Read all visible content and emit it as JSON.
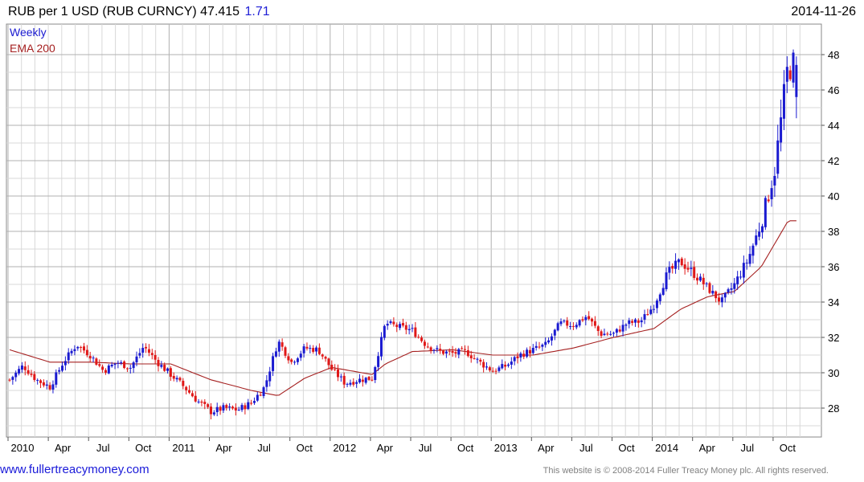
{
  "header": {
    "title": "RUB per 1 USD (RUB CURNCY) 47.415",
    "change": "1.71",
    "date": "2014-11-26"
  },
  "legend": {
    "weekly": "Weekly",
    "ema": "EMA 200"
  },
  "footer": {
    "link": "www.fullertreacymoney.com",
    "copyright": "This website is © 2008-2014 Fuller Treacy Money plc. All rights reserved."
  },
  "colors": {
    "up": "#1a1ad0",
    "down": "#e01818",
    "ema": "#a52020",
    "grid": "#d8d8d8",
    "grid_major": "#b0b0b0"
  },
  "chart_data": {
    "type": "candlestick",
    "title": "RUB per 1 USD (RUB CURNCY) 47.415",
    "frequency": "Weekly",
    "overlays": [
      "EMA 200"
    ],
    "y_ticks": [
      28,
      30,
      32,
      34,
      36,
      38,
      40,
      42,
      44,
      46,
      48
    ],
    "ylim": [
      26.5,
      49
    ],
    "x_labels": [
      "2010",
      "Apr",
      "Jul",
      "Oct",
      "2011",
      "Apr",
      "Jul",
      "Oct",
      "2012",
      "Apr",
      "Jul",
      "Oct",
      "2013",
      "Apr",
      "Jul",
      "Oct",
      "2014",
      "Apr",
      "Jul",
      "Oct"
    ],
    "close_keypoints": [
      [
        "2010-01",
        29.6
      ],
      [
        "2010-02",
        30.4
      ],
      [
        "2010-03",
        29.6
      ],
      [
        "2010-04",
        29.2
      ],
      [
        "2010-05",
        30.6
      ],
      [
        "2010-06",
        31.6
      ],
      [
        "2010-07",
        31.0
      ],
      [
        "2010-08",
        30.1
      ],
      [
        "2010-09",
        30.6
      ],
      [
        "2010-10",
        30.3
      ],
      [
        "2010-11",
        31.5
      ],
      [
        "2010-12",
        30.6
      ],
      [
        "2011-01",
        29.9
      ],
      [
        "2011-02",
        29.2
      ],
      [
        "2011-03",
        28.4
      ],
      [
        "2011-04",
        27.8
      ],
      [
        "2011-05",
        28.0
      ],
      [
        "2011-06",
        27.9
      ],
      [
        "2011-07",
        28.3
      ],
      [
        "2011-08",
        29.2
      ],
      [
        "2011-09",
        31.8
      ],
      [
        "2011-10",
        30.6
      ],
      [
        "2011-11",
        31.4
      ],
      [
        "2011-12",
        31.3
      ],
      [
        "2012-01",
        30.2
      ],
      [
        "2012-02",
        29.4
      ],
      [
        "2012-03",
        29.6
      ],
      [
        "2012-04",
        29.7
      ],
      [
        "2012-05",
        32.8
      ],
      [
        "2012-06",
        32.6
      ],
      [
        "2012-07",
        32.4
      ],
      [
        "2012-08",
        31.6
      ],
      [
        "2012-09",
        31.2
      ],
      [
        "2012-10",
        31.1
      ],
      [
        "2012-11",
        31.2
      ],
      [
        "2012-12",
        30.6
      ],
      [
        "2013-01",
        30.1
      ],
      [
        "2013-02",
        30.4
      ],
      [
        "2013-03",
        31.0
      ],
      [
        "2013-04",
        31.3
      ],
      [
        "2013-05",
        31.6
      ],
      [
        "2013-06",
        32.8
      ],
      [
        "2013-07",
        32.7
      ],
      [
        "2013-08",
        33.2
      ],
      [
        "2013-09",
        32.2
      ],
      [
        "2013-10",
        32.2
      ],
      [
        "2013-11",
        32.8
      ],
      [
        "2013-12",
        32.9
      ],
      [
        "2014-01",
        33.8
      ],
      [
        "2014-02",
        35.6
      ],
      [
        "2014-03",
        36.3
      ],
      [
        "2014-04",
        35.6
      ],
      [
        "2014-05",
        34.8
      ],
      [
        "2014-06",
        34.0
      ],
      [
        "2014-07",
        35.0
      ],
      [
        "2014-08",
        36.4
      ],
      [
        "2014-09",
        38.5
      ],
      [
        "2014-10",
        41.5
      ],
      [
        "2014-11",
        47.4
      ]
    ],
    "ema_keypoints": [
      [
        "2010-01",
        31.3
      ],
      [
        "2010-04",
        30.6
      ],
      [
        "2010-07",
        30.6
      ],
      [
        "2010-10",
        30.5
      ],
      [
        "2011-01",
        30.5
      ],
      [
        "2011-04",
        29.6
      ],
      [
        "2011-07",
        29.0
      ],
      [
        "2011-09",
        28.7
      ],
      [
        "2011-11",
        29.7
      ],
      [
        "2012-01",
        30.3
      ],
      [
        "2012-04",
        29.9
      ],
      [
        "2012-05",
        30.5
      ],
      [
        "2012-07",
        31.2
      ],
      [
        "2012-10",
        31.3
      ],
      [
        "2013-01",
        31.0
      ],
      [
        "2013-04",
        31.0
      ],
      [
        "2013-07",
        31.4
      ],
      [
        "2013-10",
        32.0
      ],
      [
        "2014-01",
        32.5
      ],
      [
        "2014-03",
        33.6
      ],
      [
        "2014-05",
        34.3
      ],
      [
        "2014-07",
        34.6
      ],
      [
        "2014-09",
        36.0
      ],
      [
        "2014-11",
        38.6
      ]
    ],
    "last_week": {
      "open": 45.6,
      "high": 47.9,
      "low": 44.4,
      "close": 47.415
    }
  }
}
